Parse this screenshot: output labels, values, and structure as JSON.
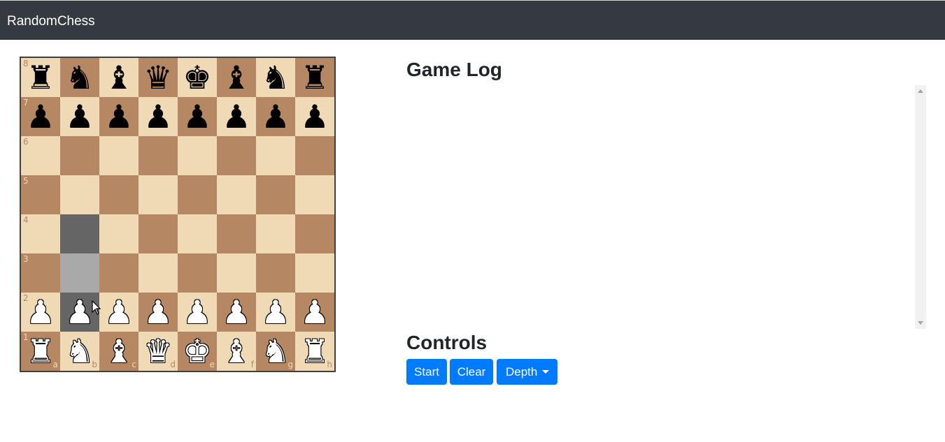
{
  "navbar": {
    "brand": "RandomChess"
  },
  "board": {
    "rank_labels": [
      "8",
      "7",
      "6",
      "5",
      "4",
      "3",
      "2",
      "1"
    ],
    "file_labels": [
      "a",
      "b",
      "c",
      "d",
      "e",
      "f",
      "g",
      "h"
    ],
    "position": [
      [
        "bR",
        "bN",
        "bB",
        "bQ",
        "bK",
        "bB",
        "bN",
        "bR"
      ],
      [
        "bP",
        "bP",
        "bP",
        "bP",
        "bP",
        "bP",
        "bP",
        "bP"
      ],
      [
        "",
        "",
        "",
        "",
        "",
        "",
        "",
        ""
      ],
      [
        "",
        "",
        "",
        "",
        "",
        "",
        "",
        ""
      ],
      [
        "",
        "",
        "",
        "",
        "",
        "",
        "",
        ""
      ],
      [
        "",
        "",
        "",
        "",
        "",
        "",
        "",
        ""
      ],
      [
        "wP",
        "wP",
        "wP",
        "wP",
        "wP",
        "wP",
        "wP",
        "wP"
      ],
      [
        "wR",
        "wN",
        "wB",
        "wQ",
        "wK",
        "wB",
        "wN",
        "wR"
      ]
    ],
    "highlighted_squares": [
      {
        "square": "b4",
        "shade": "dark"
      },
      {
        "square": "b3",
        "shade": "light"
      },
      {
        "square": "b2",
        "shade": "dark"
      }
    ],
    "colors": {
      "light": "#f0d9b5",
      "dark": "#b58863",
      "highlight_dark": "#656565",
      "highlight_light": "#a9a9a9"
    }
  },
  "game_log": {
    "heading": "Game Log",
    "entries": []
  },
  "controls": {
    "heading": "Controls",
    "start_label": "Start",
    "clear_label": "Clear",
    "depth_label": "Depth"
  },
  "colors": {
    "navbar": "#343a40",
    "primary": "#007bff"
  }
}
